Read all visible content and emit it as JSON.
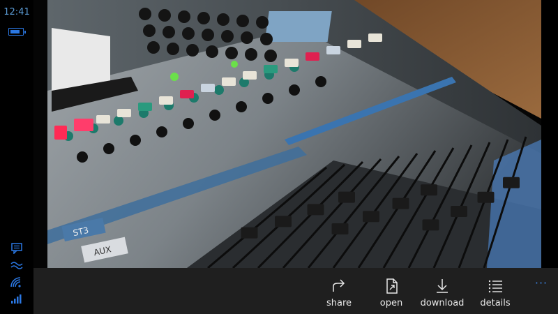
{
  "status_bar": {
    "time": "12:41",
    "battery_level": 0.8,
    "icons": [
      "battery-icon",
      "message-icon",
      "signal-wave-icon",
      "wifi-icon",
      "cell-signal-icon"
    ],
    "accent_color": "#2b78e4"
  },
  "photo": {
    "description_icon": "mixing-console-photo",
    "visible_labels": [
      "ST3",
      "AUX"
    ]
  },
  "app_bar": {
    "buttons": [
      {
        "label": "share",
        "icon": "share-icon"
      },
      {
        "label": "open",
        "icon": "open-file-icon"
      },
      {
        "label": "download",
        "icon": "download-icon"
      },
      {
        "label": "details",
        "icon": "details-list-icon"
      }
    ],
    "more_label": "···",
    "accent_color": "#3b82e0"
  }
}
